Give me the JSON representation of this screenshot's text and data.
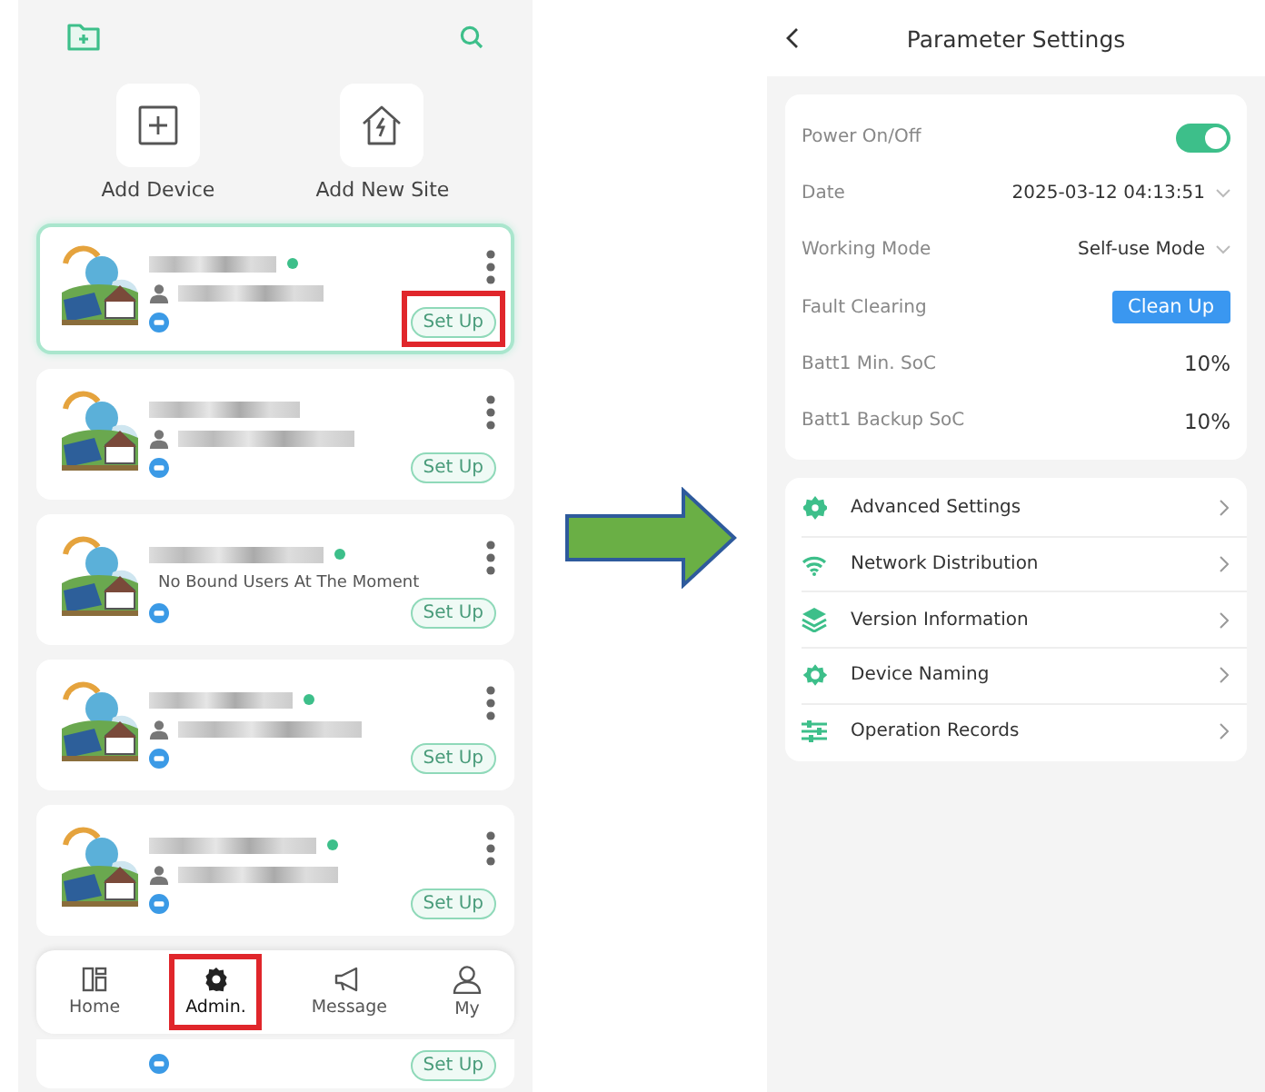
{
  "left": {
    "quick_actions": [
      {
        "label": "Add Device",
        "kind": "device"
      },
      {
        "label": "Add New Site",
        "kind": "site"
      }
    ],
    "devices": [
      {
        "online": true,
        "selected": true,
        "highlighted": true,
        "button": "Set Up"
      },
      {
        "online": false,
        "selected": false,
        "highlighted": false,
        "button": "Set Up"
      },
      {
        "online": true,
        "selected": false,
        "highlighted": false,
        "user": "No Bound Users At The Moment",
        "button": "Set Up"
      },
      {
        "online": true,
        "selected": false,
        "highlighted": false,
        "button": "Set Up"
      },
      {
        "online": true,
        "selected": false,
        "highlighted": false,
        "button": "Set Up"
      },
      {
        "kind": "partial",
        "selected": false,
        "highlighted": false,
        "button": "Set Up"
      }
    ],
    "nav": [
      {
        "label": "Home",
        "kind": "home",
        "selected": false,
        "highlighted": false
      },
      {
        "label": "Admin.",
        "kind": "admin",
        "selected": true,
        "highlighted": true
      },
      {
        "label": "Message",
        "kind": "message",
        "selected": false,
        "highlighted": false
      },
      {
        "label": "My",
        "kind": "my",
        "selected": false,
        "highlighted": false
      }
    ]
  },
  "right": {
    "title": "Parameter Settings",
    "params": [
      {
        "label": "Power On/Off",
        "kind": "toggle",
        "on": true
      },
      {
        "label": "Date",
        "kind": "select",
        "value": "2025-03-12 04:13:51"
      },
      {
        "label": "Working Mode",
        "kind": "select",
        "value": "Self-use Mode"
      },
      {
        "label": "Fault Clearing",
        "kind": "button",
        "value": "Clean Up"
      },
      {
        "label": "Batt1 Min. SoC",
        "kind": "value",
        "value": "10%"
      },
      {
        "label": "Batt1 Backup SoC",
        "kind": "value",
        "value": "10%"
      }
    ],
    "menu": [
      {
        "label": "Advanced Settings",
        "kind": "flower"
      },
      {
        "label": "Network Distribution",
        "kind": "wifi"
      },
      {
        "label": "Version Information",
        "kind": "layers"
      },
      {
        "label": "Device Naming",
        "kind": "ring"
      },
      {
        "label": "Operation Records",
        "kind": "sliders"
      }
    ]
  }
}
